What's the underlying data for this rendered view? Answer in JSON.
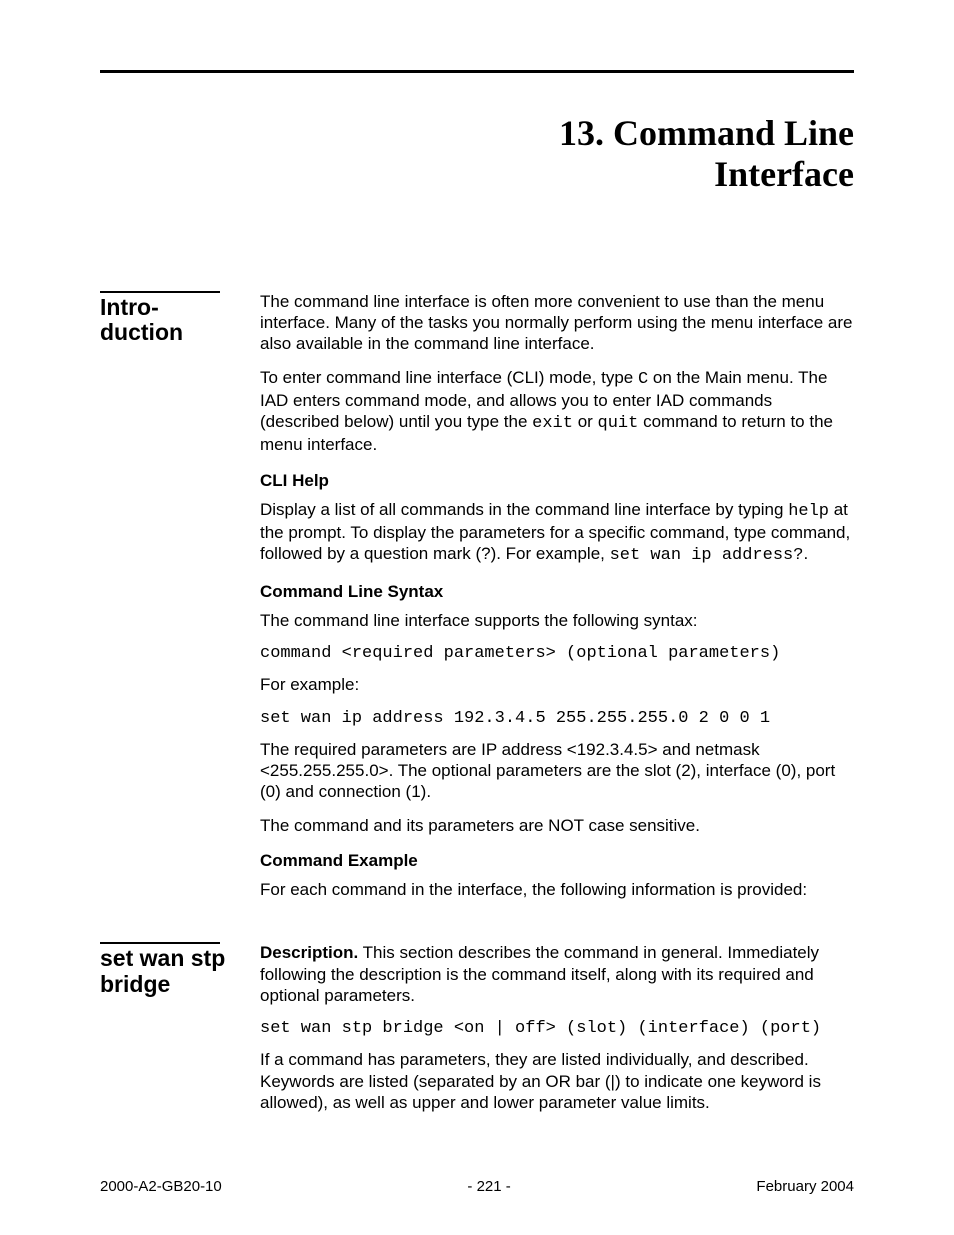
{
  "chapter": {
    "number": "13.",
    "title_line1": "Command Line",
    "title_line2": "Interface"
  },
  "sections": [
    {
      "side_heading": "Intro-\nduction",
      "blocks": [
        {
          "type": "p",
          "runs": [
            {
              "t": "The command line interface is often more convenient to use than the menu interface. Many of the tasks you normally perform using the menu interface are also available in the command line interface."
            }
          ]
        },
        {
          "type": "p",
          "runs": [
            {
              "t": "To enter command line interface (CLI) mode, type "
            },
            {
              "t": "C",
              "mono": true
            },
            {
              "t": " on the Main menu. The IAD enters command mode, and allows you to enter IAD commands (described below) until you type the "
            },
            {
              "t": "exit",
              "mono": true
            },
            {
              "t": " or "
            },
            {
              "t": "quit",
              "mono": true
            },
            {
              "t": " command to return to the menu interface."
            }
          ]
        },
        {
          "type": "sub",
          "text": "CLI Help"
        },
        {
          "type": "p",
          "runs": [
            {
              "t": "Display a list of all commands in the command line interface by typing "
            },
            {
              "t": "help",
              "mono": true
            },
            {
              "t": " at the prompt. To display the parameters for a specific command, type command, followed by a question mark (?). For example, "
            },
            {
              "t": "set wan ip address?",
              "mono": true
            },
            {
              "t": "."
            }
          ]
        },
        {
          "type": "sub",
          "text": "Command Line Syntax"
        },
        {
          "type": "p",
          "runs": [
            {
              "t": "The command line interface supports the following syntax:"
            }
          ]
        },
        {
          "type": "code",
          "text": "command <required parameters> (optional parameters)"
        },
        {
          "type": "p",
          "runs": [
            {
              "t": "For example:"
            }
          ]
        },
        {
          "type": "code",
          "text": "set wan ip address 192.3.4.5 255.255.255.0 2 0 0 1"
        },
        {
          "type": "p",
          "runs": [
            {
              "t": "The required parameters are IP address <192.3.4.5> and netmask <255.255.255.0>. The optional parameters are the slot (2), interface (0), port (0) and connection (1)."
            }
          ]
        },
        {
          "type": "p",
          "runs": [
            {
              "t": "The command and its parameters are NOT case sensitive."
            }
          ]
        },
        {
          "type": "sub",
          "text": "Command Example"
        },
        {
          "type": "p",
          "runs": [
            {
              "t": "For each command in the interface, the following information is provided:"
            }
          ]
        }
      ]
    },
    {
      "side_heading": "set wan stp bridge",
      "blocks": [
        {
          "type": "p",
          "runs": [
            {
              "t": "Description.",
              "bold": true
            },
            {
              "t": " This section describes the command in general. Immediately following the description is the command itself, along with its required and optional parameters."
            }
          ]
        },
        {
          "type": "code",
          "text": "set wan stp bridge <on | off> (slot) (interface) (port)"
        },
        {
          "type": "p",
          "runs": [
            {
              "t": "If a command has parameters, they are listed individually, and described. Keywords are listed (separated by an OR bar (|) to indicate one keyword is allowed), as well as upper and lower parameter value limits."
            }
          ]
        }
      ]
    }
  ],
  "footer": {
    "left": "2000-A2-GB20-10",
    "center": "- 221 -",
    "right": "February 2004"
  }
}
